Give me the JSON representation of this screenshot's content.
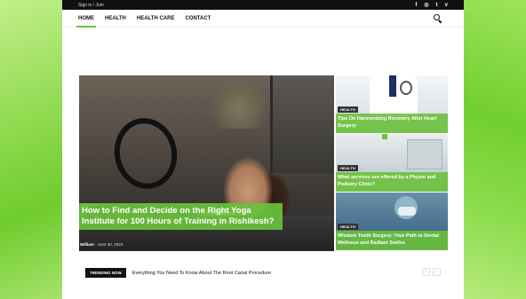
{
  "topbar": {
    "signin_label": "Sign in / Join",
    "social": [
      "f",
      "◎",
      "t",
      "v"
    ]
  },
  "nav": {
    "items": [
      "HOME",
      "HEALTH",
      "HEALTH CARE",
      "CONTACT"
    ],
    "active": "HOME"
  },
  "main_post": {
    "category": "HEALTH",
    "title": "How to Find and Decide on the Right Yoga Institute for 100 Hours of Training in Rishikesh?",
    "author": "William",
    "date": "June 30, 2023"
  },
  "side_posts": [
    {
      "category": "HEALTH",
      "title": "Tips On Harmonizing Recovery After Heart Surgery"
    },
    {
      "category": "HEALTH",
      "title": "What services are offered by a Physio and Podiatry Clinic?"
    },
    {
      "category": "HEALTH",
      "title": "Wisdom Tooth Surgery: Your Path to Dental Wellness and Radiant Smiles"
    }
  ],
  "trending": {
    "label": "TRENDING NOW",
    "text": "Everything You Need To Know About The Root Canal Procedure",
    "prev": "‹",
    "next": "›"
  },
  "colors": {
    "accent": "#6ac13c",
    "topbar": "#111111"
  }
}
